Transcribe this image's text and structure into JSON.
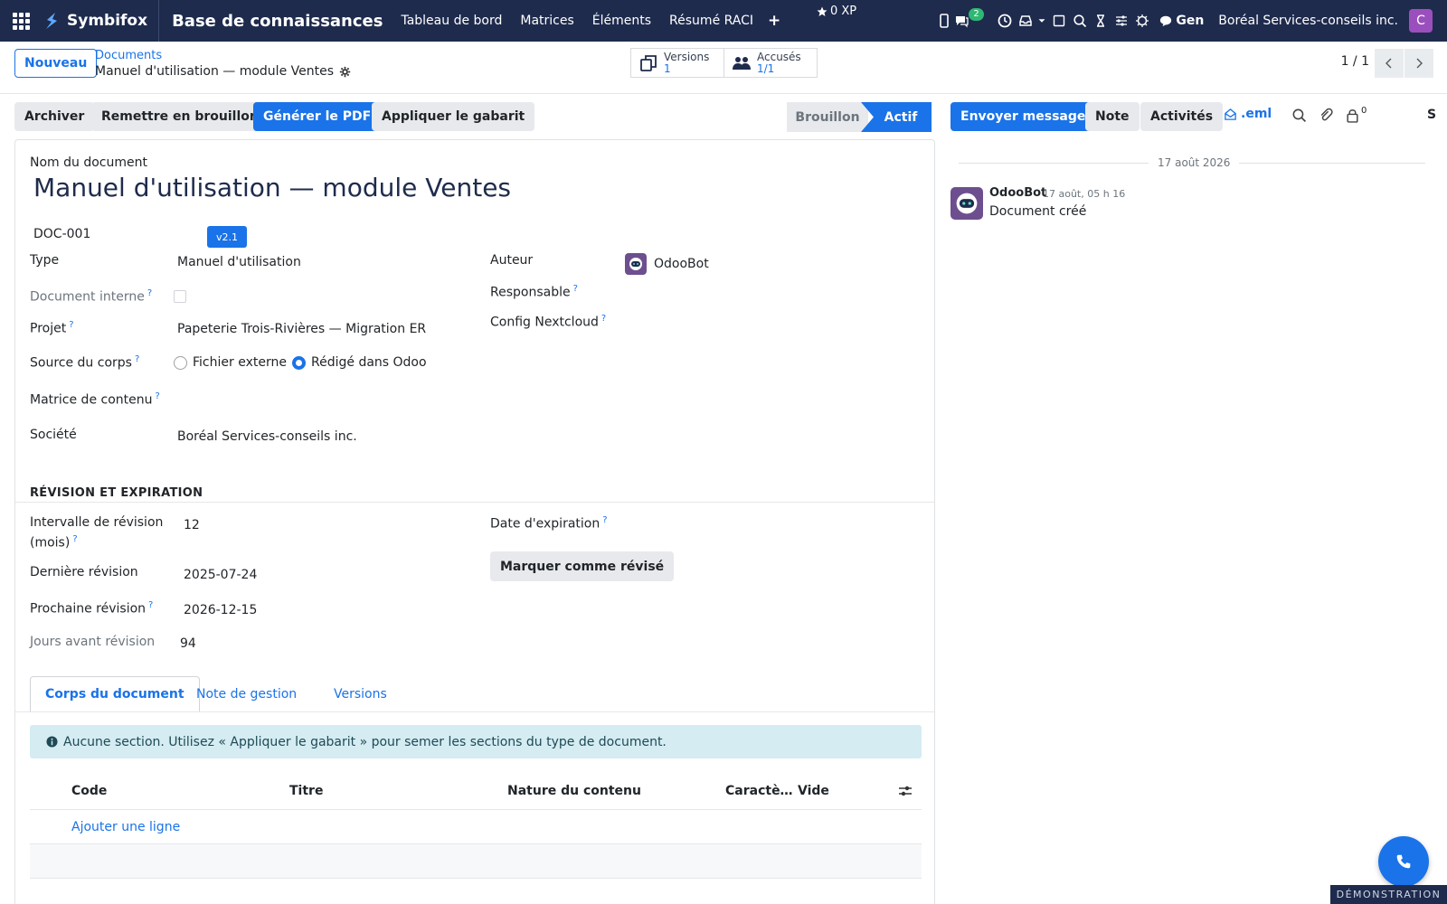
{
  "navbar": {
    "brand": "Symbifox",
    "app_title": "Base de connaissances",
    "menu": [
      "Tableau de bord",
      "Matrices",
      "Éléments",
      "Résumé RACI"
    ],
    "plus": "+",
    "xp": "0 XP",
    "messages_badge": "2",
    "gen_label": "Gen",
    "company": "Boréal Services-conseils inc.",
    "avatar_letter": "C"
  },
  "control": {
    "new_button": "Nouveau",
    "breadcrumb_parent": "Documents",
    "breadcrumb_current": "Manuel d'utilisation — module Ventes",
    "smart_buttons": {
      "versions": {
        "label": "Versions",
        "value": "1"
      },
      "accuses": {
        "label": "Accusés",
        "value": "1/1"
      }
    },
    "pager": "1 / 1"
  },
  "actions": {
    "archive": "Archiver",
    "reset_draft": "Remettre en brouillon",
    "generate_pdf": "Générer le PDF",
    "apply_template": "Appliquer le gabarit",
    "status_draft": "Brouillon",
    "status_active": "Actif"
  },
  "chatter_actions": {
    "send_message": "Envoyer message",
    "note": "Note",
    "activities": "Activités",
    "eml": ".eml",
    "followers_count": "0",
    "s_label": "S"
  },
  "form": {
    "name_label": "Nom du document",
    "name": "Manuel d'utilisation — module Ventes",
    "reference": "DOC-001",
    "version": "v2.1",
    "type_label": "Type",
    "type": "Manuel d'utilisation",
    "internal_label": "Document interne",
    "project_label": "Projet",
    "project": "Papeterie Trois-Rivières — Migration ER",
    "body_source_label": "Source du corps",
    "body_source_options": [
      "Fichier externe",
      "Rédigé dans Odoo"
    ],
    "body_source_selected": "Rédigé dans Odoo",
    "matrix_label": "Matrice de contenu",
    "company_label": "Société",
    "company": "Boréal Services-conseils inc.",
    "author_label": "Auteur",
    "author": "OdooBot",
    "responsible_label": "Responsable",
    "nextcloud_label": "Config Nextcloud",
    "q": "?"
  },
  "revision": {
    "section_title": "RÉVISION ET EXPIRATION",
    "interval_label_1": "Intervalle de révision",
    "interval_label_2": "(mois)",
    "interval": "12",
    "last_label": "Dernière révision",
    "last": "2025-07-24",
    "next_label": "Prochaine révision",
    "next": "2026-12-15",
    "days_label": "Jours avant révision",
    "days": "94",
    "expiration_label": "Date d'expiration",
    "mark_reviewed": "Marquer comme révisé"
  },
  "tabs": [
    "Corps du document",
    "Note de gestion",
    "Versions"
  ],
  "alert": "Aucune section. Utilisez « Appliquer le gabarit » pour semer les sections du type de document.",
  "table": {
    "columns": [
      "Code",
      "Titre",
      "Nature du contenu",
      "Caractè…",
      "Vide"
    ],
    "add_line": "Ajouter une ligne"
  },
  "chatter": {
    "date": "17 août 2026",
    "messages": [
      {
        "author": "OdooBot",
        "date": "17 août, 05 h 16",
        "body": "Document créé"
      }
    ]
  },
  "demo": "DÉMONSTRATION",
  "colors": {
    "navbar": "#1e2b4d",
    "primary": "#1a73e8",
    "avatar": "#9b4fbd",
    "badge": "#2eb872"
  }
}
